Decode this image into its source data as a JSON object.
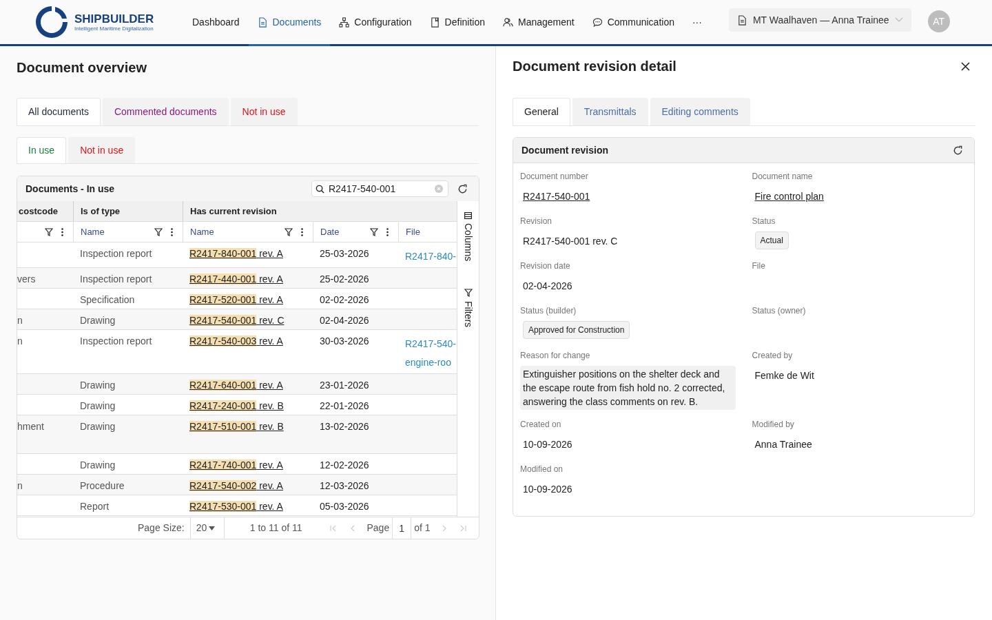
{
  "app": {
    "logo_title": "SHIPBUILDER",
    "logo_subtitle": "Intelligent Maritime Digitalization"
  },
  "nav": [
    {
      "label": "Dashboard",
      "selected": false
    },
    {
      "label": "Documents",
      "selected": true
    },
    {
      "label": "Configuration",
      "selected": false
    },
    {
      "label": "Definition",
      "selected": false
    },
    {
      "label": "Management",
      "selected": false
    },
    {
      "label": "Communication",
      "selected": false
    },
    {
      "label": "···",
      "selected": false
    }
  ],
  "context_selector": "MT Waalhaven — Anna Trainee",
  "avatar": "AT",
  "overview": {
    "title": "Document overview",
    "tabs": [
      {
        "label": "All documents",
        "selected": true,
        "color": "#1f2937"
      },
      {
        "label": "Commented documents",
        "selected": false,
        "color": "#8a1a7e"
      },
      {
        "label": "Not in use",
        "selected": false,
        "color": "#e0121b"
      }
    ],
    "subtabs": [
      {
        "label": "In use",
        "selected": true,
        "color": "#15803d"
      },
      {
        "label": "Not in use",
        "selected": false,
        "color": "#e0121b"
      }
    ],
    "grid": {
      "title": "Documents - In use",
      "search": "R2417-540-001",
      "groups": [
        "costcode",
        "Is of type",
        "Has current revision"
      ],
      "columns": [
        "Name",
        "Name",
        "Date",
        "File"
      ],
      "rows": [
        {
          "costcode": "",
          "type": "Inspection report",
          "number": "R2417-840-001",
          "rev": "rev. A",
          "date": "25-03-2026",
          "file": [
            "R2417-840-"
          ]
        },
        {
          "costcode": "vers",
          "type": "Inspection report",
          "number": "R2417-440-001",
          "rev": "rev. A",
          "date": "25-02-2026",
          "file": []
        },
        {
          "costcode": "",
          "type": "Specification",
          "number": "R2417-520-001",
          "rev": "rev. A",
          "date": "02-02-2026",
          "file": []
        },
        {
          "costcode": "n",
          "type": "Drawing",
          "number": "R2417-540-001",
          "rev": "rev. C",
          "date": "02-04-2026",
          "file": []
        },
        {
          "costcode": "n",
          "type": "Inspection report",
          "number": "R2417-540-003",
          "rev": "rev. A",
          "date": "30-03-2026",
          "file": [
            "R2417-540-",
            "engine-roo"
          ]
        },
        {
          "costcode": "",
          "type": "Drawing",
          "number": "R2417-640-001",
          "rev": "rev. A",
          "date": "23-01-2026",
          "file": []
        },
        {
          "costcode": "",
          "type": "Drawing",
          "number": "R2417-240-001",
          "rev": "rev. B",
          "date": "22-01-2026",
          "file": []
        },
        {
          "costcode": "hment",
          "type": "Drawing",
          "number": "R2417-510-001",
          "rev": "rev. B",
          "date": "13-02-2026",
          "file": []
        },
        {
          "costcode": "",
          "type": "Drawing",
          "number": "R2417-740-001",
          "rev": "rev. A",
          "date": "12-02-2026",
          "file": []
        },
        {
          "costcode": "n",
          "type": "Procedure",
          "number": "R2417-540-002",
          "rev": "rev. A",
          "date": "12-03-2026",
          "file": []
        },
        {
          "costcode": "",
          "type": "Report",
          "number": "R2417-530-001",
          "rev": "rev. A",
          "date": "05-03-2026",
          "file": []
        }
      ],
      "side_tabs": [
        "Columns",
        "Filters"
      ],
      "page_size_label": "Page Size:",
      "page_size": "20",
      "range": "1 to 11 of 11",
      "page_label": "Page",
      "page": "1",
      "page_of": "of 1"
    }
  },
  "detail": {
    "title": "Document revision detail",
    "tabs": [
      {
        "label": "General",
        "selected": true
      },
      {
        "label": "Transmittals",
        "selected": false
      },
      {
        "label": "Editing comments",
        "selected": false
      }
    ],
    "card_title": "Document revision",
    "fields": [
      {
        "label": "Document number",
        "value": "R2417-540-001",
        "kind": "link"
      },
      {
        "label": "Document name",
        "value": "Fire control plan",
        "kind": "link"
      },
      {
        "label": "Revision",
        "value": "R2417-540-001 rev. C",
        "kind": "text"
      },
      {
        "label": "Status",
        "value": "Actual",
        "kind": "badge"
      },
      {
        "label": "Revision date",
        "value": "02-04-2026",
        "kind": "text"
      },
      {
        "label": "File",
        "kind": "empty"
      },
      {
        "label": "Status (builder)",
        "value": "Approved for Construction",
        "kind": "badge"
      },
      {
        "label": "Status (owner)",
        "kind": "empty"
      },
      {
        "label": "Reason for change",
        "value": "Extinguisher positions on the shelter deck and the escape route from fish hold no. 2 corrected, answering the class comments on rev. B.",
        "kind": "note"
      },
      {
        "label": "Created by",
        "value": "Femke de Wit",
        "kind": "text"
      },
      {
        "label": "Created on",
        "value": "10-09-2026",
        "kind": "text"
      },
      {
        "label": "Modified by",
        "value": "Anna Trainee",
        "kind": "text"
      },
      {
        "label": "Modified on",
        "value": "10-09-2026",
        "kind": "text"
      }
    ]
  }
}
